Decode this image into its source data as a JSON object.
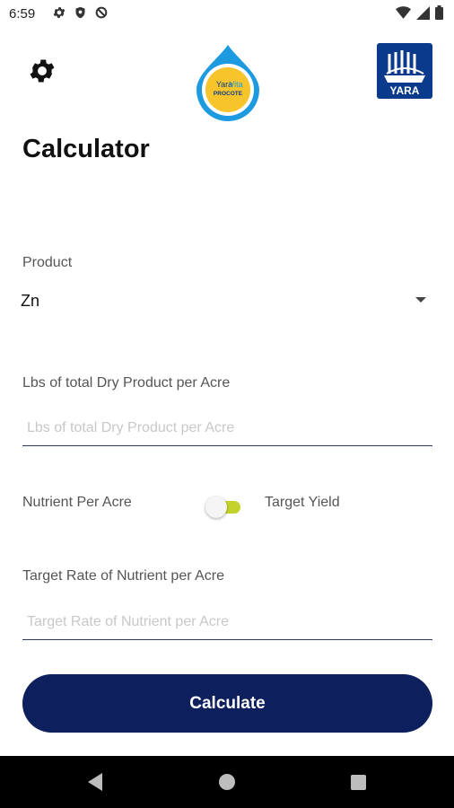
{
  "status_bar": {
    "time": "6:59",
    "left_icons": [
      "gear-icon",
      "shield-icon",
      "no-sync-icon"
    ],
    "right_icons": [
      "wifi-icon",
      "signal-icon",
      "battery-icon"
    ]
  },
  "header": {
    "settings_icon": "gear-icon",
    "logo_badge": {
      "line1": "Yara",
      "line2": "Vita",
      "line3": "PROCOTE"
    },
    "brand_logo_text": "YARA"
  },
  "title": "Calculator",
  "form": {
    "product_label": "Product",
    "product_value": "Zn",
    "lbs_label": "Lbs of total Dry Product per Acre",
    "lbs_placeholder": "Lbs of total Dry Product per Acre",
    "lbs_value": "",
    "toggle_left_label": "Nutrient Per Acre",
    "toggle_right_label": "Target Yield",
    "toggle_on": true,
    "target_rate_label": "Target Rate of Nutrient per Acre",
    "target_rate_placeholder": "Target Rate of Nutrient per Acre",
    "target_rate_value": "",
    "calculate_label": "Calculate"
  },
  "colors": {
    "button_bg": "#0d1f5c",
    "toggle_accent": "#c3d32b",
    "yara_blue": "#0a3a8c",
    "badge_blue": "#1e9be0",
    "badge_yellow": "#f7c52b"
  },
  "nav_bar": {
    "icons": [
      "back-icon",
      "home-icon",
      "recents-icon"
    ]
  }
}
